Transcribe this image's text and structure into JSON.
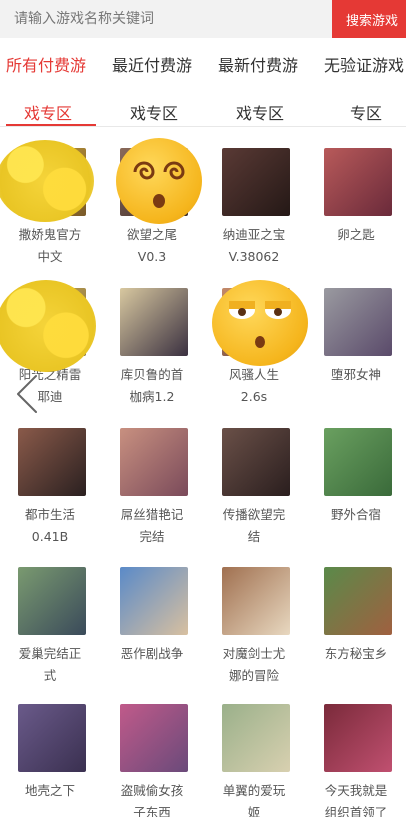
{
  "search": {
    "placeholder": "请输入游戏名称关键词",
    "button_label": "搜索游戏"
  },
  "tabs": [
    {
      "line1": "所有付费游",
      "line2": "戏专区",
      "active": true
    },
    {
      "line1": "最近付费游",
      "line2": "戏专区",
      "active": false
    },
    {
      "line1": "最新付费游",
      "line2": "戏专区",
      "active": false
    },
    {
      "line1": "无验证游戏",
      "line2": "专区",
      "active": false
    }
  ],
  "games": [
    {
      "caption": "撒娇鬼官方\n中文",
      "colors": [
        "#c9a33b",
        "#7a5a2a"
      ]
    },
    {
      "caption": "欲望之尾\nV0.3",
      "colors": [
        "#8a6a5a",
        "#3a2a2a"
      ]
    },
    {
      "caption": "纳迪亚之宝\nV.38062",
      "colors": [
        "#5a3a35",
        "#241816"
      ]
    },
    {
      "caption": "卵之匙",
      "colors": [
        "#b85a5a",
        "#6a2a3a"
      ]
    },
    {
      "caption": "阳光之精雷\n耶迪",
      "colors": [
        "#d4b04a",
        "#7a6a4a"
      ]
    },
    {
      "caption": "库贝鲁的首\n枷病1.2",
      "colors": [
        "#d8c8a0",
        "#3a3040"
      ]
    },
    {
      "caption": "风骚人生\n2.6s",
      "colors": [
        "#c48a6a",
        "#5a3a30"
      ]
    },
    {
      "caption": "堕邪女神",
      "colors": [
        "#9a9aa0",
        "#5a4a6a"
      ]
    },
    {
      "caption": "都市生活\n0.41B",
      "colors": [
        "#8a5a4a",
        "#2a2020"
      ]
    },
    {
      "caption": "屌丝猎艳记\n完结",
      "colors": [
        "#c89080",
        "#7a4a5a"
      ]
    },
    {
      "caption": "传播欲望完\n结",
      "colors": [
        "#6a5048",
        "#2a1e1e"
      ]
    },
    {
      "caption": "野外合宿",
      "colors": [
        "#6aa060",
        "#3a6a3a"
      ]
    },
    {
      "caption": "爱巢完结正\n式",
      "colors": [
        "#7a9a70",
        "#3a4a5a"
      ]
    },
    {
      "caption": "恶作剧战争",
      "colors": [
        "#5a8ac8",
        "#d8c0a0"
      ]
    },
    {
      "caption": "对魔剑士尤\n娜的冒险",
      "colors": [
        "#a07050",
        "#e8d8c0"
      ]
    },
    {
      "caption": "东方秘宝乡",
      "colors": [
        "#5a8a4a",
        "#a06040"
      ]
    },
    {
      "caption": "地壳之下",
      "colors": [
        "#6a5a8a",
        "#3a3050"
      ]
    },
    {
      "caption": "盗贼偷女孩\n子东西",
      "colors": [
        "#c05a8a",
        "#6a4a7a"
      ]
    },
    {
      "caption": "单翼的爱玩\n姬",
      "colors": [
        "#9ab08a",
        "#d8d0b0"
      ]
    },
    {
      "caption": "今天我就是\n组织首领了",
      "colors": [
        "#7a2a3a",
        "#c05070"
      ]
    }
  ],
  "icons": {
    "back": "chevron-left-icon",
    "emoji_dizzy": "dizzy-face-emoji",
    "emoji_unamused": "unamused-face-emoji"
  },
  "colors": {
    "accent": "#e53935",
    "search_bg": "#f2f2f2"
  }
}
